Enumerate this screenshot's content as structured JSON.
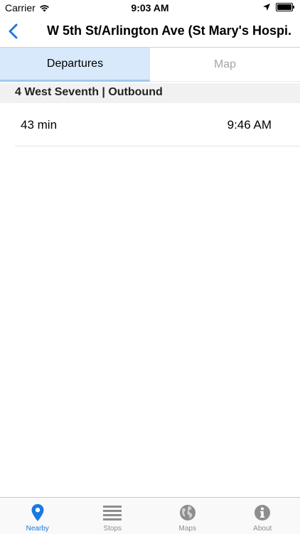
{
  "status_bar": {
    "carrier": "Carrier",
    "time": "9:03 AM"
  },
  "nav": {
    "title": "W 5th St/Arlington Ave (St Mary's Hospi..."
  },
  "tabs": [
    {
      "label": "Departures",
      "active": true
    },
    {
      "label": "Map",
      "active": false
    }
  ],
  "section": {
    "title": "4 West Seventh | Outbound"
  },
  "departures": [
    {
      "countdown": "43 min",
      "time": "9:46 AM"
    }
  ],
  "tab_bar": {
    "items": [
      {
        "label": "Nearby",
        "icon": "location-pin-icon",
        "active": true
      },
      {
        "label": "Stops",
        "icon": "list-icon",
        "active": false
      },
      {
        "label": "Maps",
        "icon": "globe-icon",
        "active": false
      },
      {
        "label": "About",
        "icon": "info-icon",
        "active": false
      }
    ]
  },
  "colors": {
    "accent": "#1a7ae0",
    "tab_active_bg": "#d7e9fb",
    "inactive": "#8e8e8e"
  }
}
